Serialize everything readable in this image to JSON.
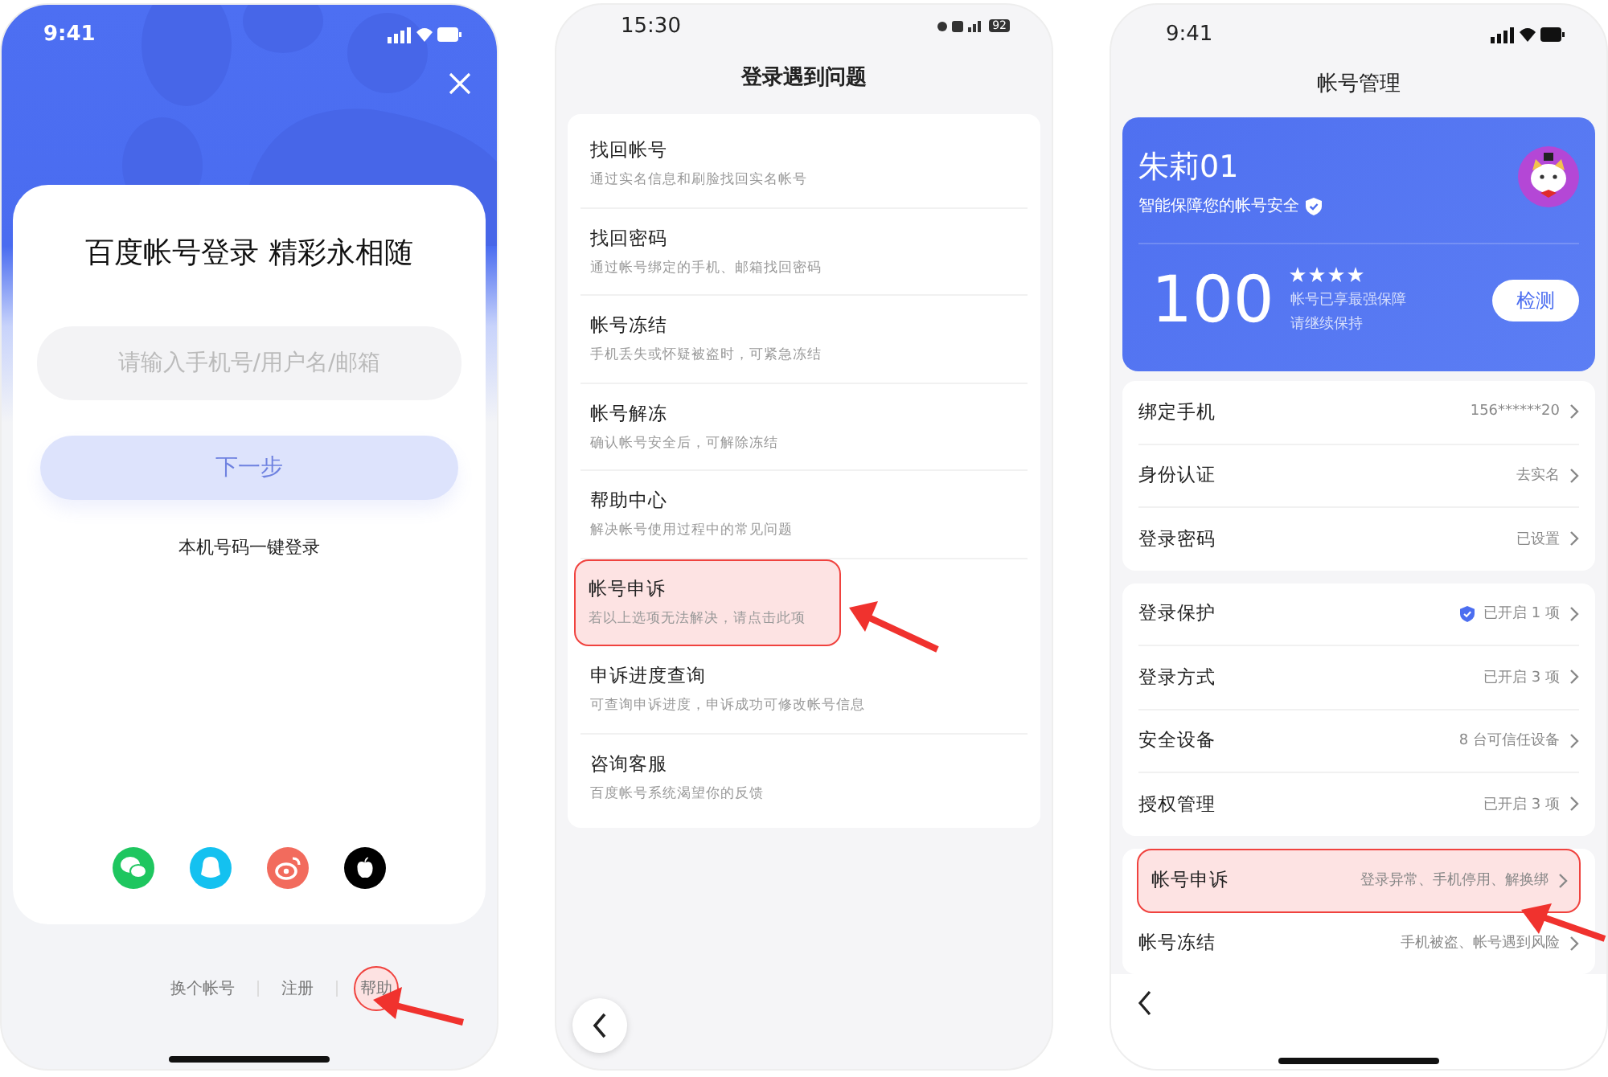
{
  "login_screen": {
    "status_time": "9:41",
    "title": "百度帐号登录 精彩永相随",
    "input": {
      "placeholder": "请输入手机号/用户名/邮箱"
    },
    "next_button": "下一步",
    "one_tap_login": "本机号码一键登录",
    "social_logins": [
      {
        "kind": "wechat"
      },
      {
        "kind": "qq"
      },
      {
        "kind": "weibo"
      },
      {
        "kind": "apple"
      }
    ],
    "footer_links": [
      {
        "label": "换个帐号",
        "highlighted": false
      },
      {
        "label": "注册",
        "highlighted": false
      },
      {
        "label": "帮助",
        "highlighted": true
      }
    ]
  },
  "problem_screen": {
    "status_time": "15:30",
    "battery": "92",
    "title": "登录遇到问题",
    "items": [
      {
        "title": "找回帐号",
        "desc": "通过实名信息和刷脸找回实名帐号",
        "highlighted": false
      },
      {
        "title": "找回密码",
        "desc": "通过帐号绑定的手机、邮箱找回密码",
        "highlighted": false
      },
      {
        "title": "帐号冻结",
        "desc": "手机丢失或怀疑被盗时，可紧急冻结",
        "highlighted": false
      },
      {
        "title": "帐号解冻",
        "desc": "确认帐号安全后，可解除冻结",
        "highlighted": false
      },
      {
        "title": "帮助中心",
        "desc": "解决帐号使用过程中的常见问题",
        "highlighted": false
      },
      {
        "title": "帐号申诉",
        "desc": "若以上选项无法解决，请点击此项",
        "highlighted": true
      },
      {
        "title": "申诉进度查询",
        "desc": "可查询申诉进度，申诉成功可修改帐号信息",
        "highlighted": false
      },
      {
        "title": "咨询客服",
        "desc": "百度帐号系统渴望你的反馈",
        "highlighted": false
      }
    ]
  },
  "account_screen": {
    "status_time": "9:41",
    "title": "帐号管理",
    "card": {
      "name": "朱莉01",
      "subtitle": "智能保障您的帐号安全",
      "score": "100",
      "stars": 4,
      "status_line_1": "帐号已享最强保障",
      "status_line_2": "请继续保持",
      "check_button": "检测"
    },
    "groups": [
      [
        {
          "label": "绑定手机",
          "value": "156******20",
          "shield": false,
          "highlighted": false
        },
        {
          "label": "身份认证",
          "value": "去实名",
          "shield": false,
          "highlighted": false
        },
        {
          "label": "登录密码",
          "value": "已设置",
          "shield": false,
          "highlighted": false
        }
      ],
      [
        {
          "label": "登录保护",
          "value": "已开启 1 项",
          "shield": true,
          "highlighted": false
        },
        {
          "label": "登录方式",
          "value": "已开启 3 项",
          "shield": false,
          "highlighted": false
        },
        {
          "label": "安全设备",
          "value": "8 台可信任设备",
          "shield": false,
          "highlighted": false
        },
        {
          "label": "授权管理",
          "value": "已开启 3 项",
          "shield": false,
          "highlighted": false
        }
      ],
      [
        {
          "label": "帐号申诉",
          "value": "登录异常、手机停用、解换绑",
          "shield": false,
          "highlighted": true
        },
        {
          "label": "帐号冻结",
          "value": "手机被盗、帐号遇到风险",
          "shield": false,
          "highlighted": false
        }
      ]
    ]
  }
}
